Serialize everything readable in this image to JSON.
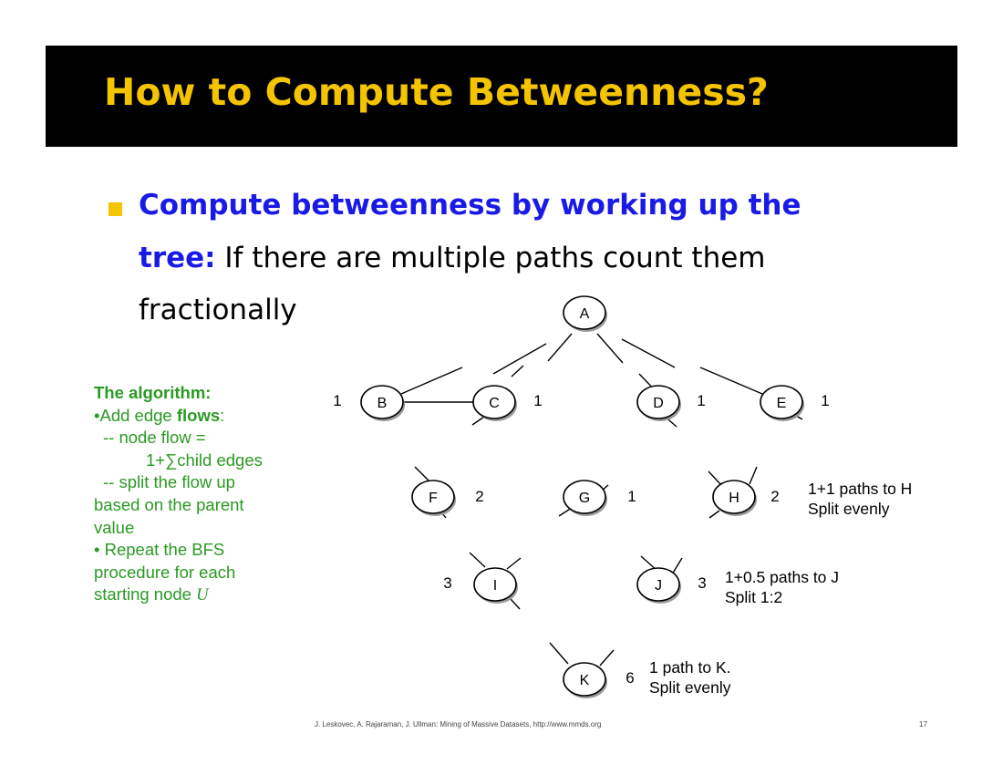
{
  "title": "How to Compute Betweenness?",
  "bullet": {
    "bold_part": "Compute betweenness by working up the",
    "line2_bold": "tree:",
    "line2_rest": " If there are multiple paths count them",
    "line3": "fractionally"
  },
  "algorithm": {
    "heading": "The algorithm:",
    "line1_pre": "•Add edge ",
    "line1_bold": "flows",
    "line1_post": ":",
    "line2": "-- node flow =",
    "line3": "1+∑child edges",
    "line4": "-- split the flow up",
    "line5": "based on the parent",
    "line6": "value",
    "line7": "• Repeat the BFS",
    "line8": "procedure for each",
    "line9_pre": "starting node ",
    "line9_var": "U"
  },
  "nodes": [
    {
      "id": "A",
      "value": ""
    },
    {
      "id": "B",
      "value": "1"
    },
    {
      "id": "C",
      "value": "1"
    },
    {
      "id": "D",
      "value": "1"
    },
    {
      "id": "E",
      "value": "1"
    },
    {
      "id": "F",
      "value": "2"
    },
    {
      "id": "G",
      "value": "1"
    },
    {
      "id": "H",
      "value": "2"
    },
    {
      "id": "I",
      "value": "3"
    },
    {
      "id": "J",
      "value": "3"
    },
    {
      "id": "K",
      "value": "6"
    }
  ],
  "notes": {
    "h_line1": "1+1 paths to H",
    "h_line2": "Split evenly",
    "j_line1": "1+0.5 paths to J",
    "j_line2": "Split 1:2",
    "k_line1": "1 path to K.",
    "k_line2": "Split evenly"
  },
  "footer": {
    "citation": "J. Leskovec, A. Rajaraman, J. Ullman: Mining of Massive Datasets, http://www.mmds.org",
    "page": "17"
  },
  "colors": {
    "title": "#f5c400",
    "emphasis": "#1a1ae6",
    "algorithm": "#2a9a22"
  }
}
